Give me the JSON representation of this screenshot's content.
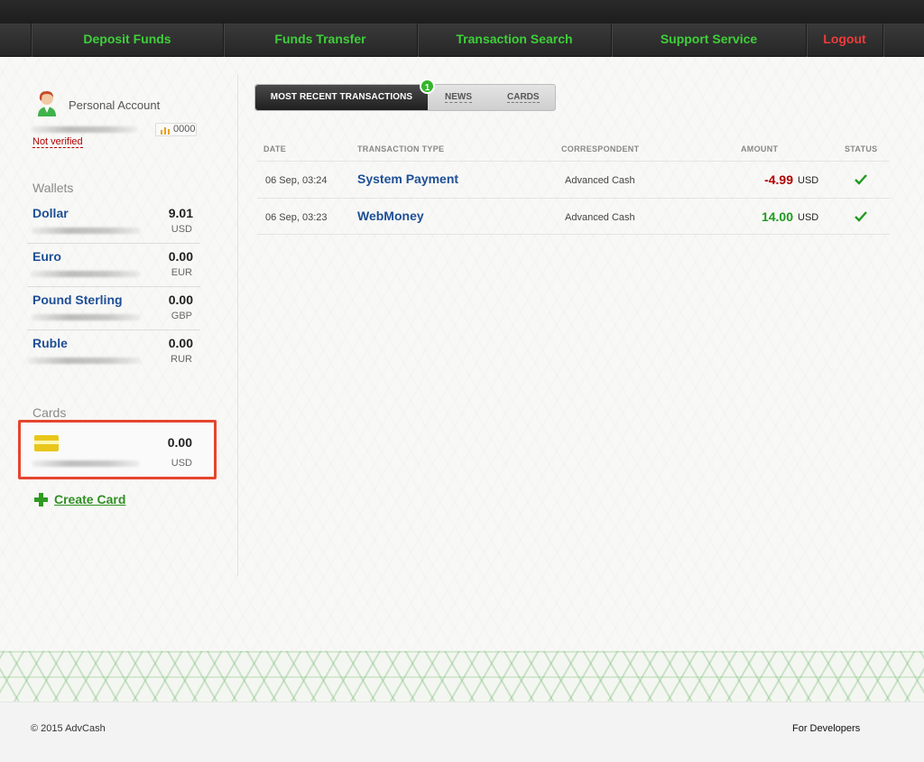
{
  "nav": {
    "items": [
      {
        "label": "Deposit Funds"
      },
      {
        "label": "Funds Transfer"
      },
      {
        "label": "Transaction Search"
      },
      {
        "label": "Support Service"
      },
      {
        "label": "Logout"
      }
    ]
  },
  "account": {
    "title": "Personal Account",
    "status": "Not verified",
    "rating": "0000"
  },
  "wallets": {
    "title": "Wallets",
    "items": [
      {
        "name": "Dollar",
        "amount": "9.01",
        "currency": "USD"
      },
      {
        "name": "Euro",
        "amount": "0.00",
        "currency": "EUR"
      },
      {
        "name": "Pound Sterling",
        "amount": "0.00",
        "currency": "GBP"
      },
      {
        "name": "Ruble",
        "amount": "0.00",
        "currency": "RUR"
      }
    ]
  },
  "cards": {
    "title": "Cards",
    "items": [
      {
        "amount": "0.00",
        "currency": "USD"
      }
    ],
    "create_label": "Create Card"
  },
  "tabs": {
    "active": "MOST RECENT TRANSACTIONS",
    "badge": "1",
    "news": "NEWS",
    "cards": "CARDS"
  },
  "transactions": {
    "headers": {
      "date": "DATE",
      "type": "TRANSACTION TYPE",
      "correspondent": "CORRESPONDENT",
      "amount": "AMOUNT",
      "status": "STATUS"
    },
    "rows": [
      {
        "date": "06 Sep, 03:24",
        "type": "System Payment",
        "correspondent": "Advanced Cash",
        "amount": "-4.99",
        "currency": "USD",
        "status": "completed"
      },
      {
        "date": "06 Sep, 03:23",
        "type": "WebMoney",
        "correspondent": "Advanced Cash",
        "amount": "14.00",
        "currency": "USD",
        "status": "completed"
      }
    ]
  },
  "footer": {
    "copyright": "© 2015 AdvCash",
    "developers": "For Developers"
  },
  "colors": {
    "nav_text": "#3fcf3a",
    "logout": "#ef3b3b",
    "link": "#1e4f96",
    "negative": "#b30000",
    "positive": "#1f9a1f",
    "highlight_border": "#e6452f"
  }
}
